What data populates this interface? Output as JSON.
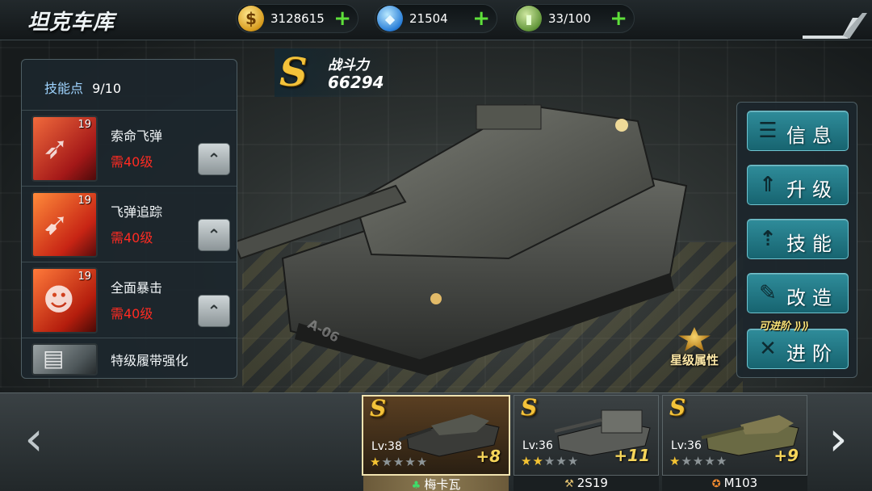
{
  "header": {
    "title": "坦克车库",
    "resources": [
      {
        "icon": "gold-coin-icon",
        "symbol": "$",
        "value": "3128615",
        "plus": "+"
      },
      {
        "icon": "diamond-icon",
        "symbol": "◆",
        "value": "21504",
        "plus": "+"
      },
      {
        "icon": "fuel-can-icon",
        "symbol": "▮",
        "value": "33/100",
        "plus": "+"
      }
    ]
  },
  "power": {
    "rank": "S",
    "label": "战斗力",
    "value": "66294"
  },
  "skills": {
    "points_label": "技能点",
    "points_value": "9/10",
    "items": [
      {
        "name": "索命飞弹",
        "level": "19",
        "requirement": "需40级",
        "icon": "missile-salvo-icon"
      },
      {
        "name": "飞弹追踪",
        "level": "19",
        "requirement": "需40级",
        "icon": "missile-tracking-icon"
      },
      {
        "name": "全面暴击",
        "level": "19",
        "requirement": "需40级",
        "icon": "soldier-critical-icon"
      },
      {
        "name": "特级履带强化",
        "level": "",
        "requirement": "",
        "icon": "tank-tread-icon"
      }
    ]
  },
  "menu": {
    "buttons": [
      {
        "label": "信息",
        "icon": "info-icon",
        "glyph": "☰"
      },
      {
        "label": "升级",
        "icon": "upgrade-icon",
        "glyph": "⇑"
      },
      {
        "label": "技能",
        "icon": "skill-icon",
        "glyph": "⇡"
      },
      {
        "label": "改造",
        "icon": "modify-icon",
        "glyph": "✎"
      },
      {
        "label": "进阶",
        "icon": "advance-icon",
        "glyph": "✕",
        "badge": "可进阶 ⟫⟫"
      }
    ]
  },
  "scene": {
    "floor_mark": "A-06",
    "star_attribute_label": "星级属性"
  },
  "carousel": {
    "cards": [
      {
        "rank": "S",
        "level": "Lv:38",
        "stars": 1,
        "max_stars": 5,
        "bonus": "+8",
        "name": "梅卡瓦",
        "name_icon": "♣",
        "name_icon_color": "#3fdc6a",
        "selected": true
      },
      {
        "rank": "S",
        "level": "Lv:36",
        "stars": 2,
        "max_stars": 5,
        "bonus": "+11",
        "name": "2S19",
        "name_icon": "⚒",
        "name_icon_color": "#e0c070",
        "selected": false
      },
      {
        "rank": "S",
        "level": "Lv:36",
        "stars": 1,
        "max_stars": 5,
        "bonus": "+9",
        "name": "M103",
        "name_icon": "✪",
        "name_icon_color": "#f08a30",
        "selected": false
      }
    ]
  }
}
